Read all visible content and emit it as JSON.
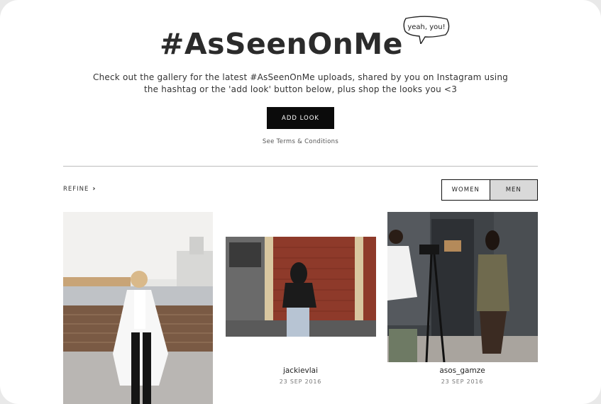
{
  "hero": {
    "title": "#AsSeenOnMe",
    "bubble": "yeah, you!",
    "intro": "Check out the gallery for the latest #AsSeenOnMe uploads, shared by you on Instagram using the hashtag or the 'add look' button below, plus shop the looks you <3",
    "add_look_label": "ADD LOOK",
    "terms_label": "See Terms & Conditions"
  },
  "filter": {
    "refine_label": "REFINE",
    "women_label": "WOMEN",
    "men_label": "MEN",
    "selected": "MEN"
  },
  "gallery": [
    {
      "username": "",
      "date": ""
    },
    {
      "username": "jackievlai",
      "date": "23 SEP 2016"
    },
    {
      "username": "asos_gamze",
      "date": "23 SEP 2016"
    }
  ],
  "colors": {
    "accent": "#0b0b0b",
    "selected_toggle": "#d9d9d9",
    "divider": "#bdbdbd"
  }
}
